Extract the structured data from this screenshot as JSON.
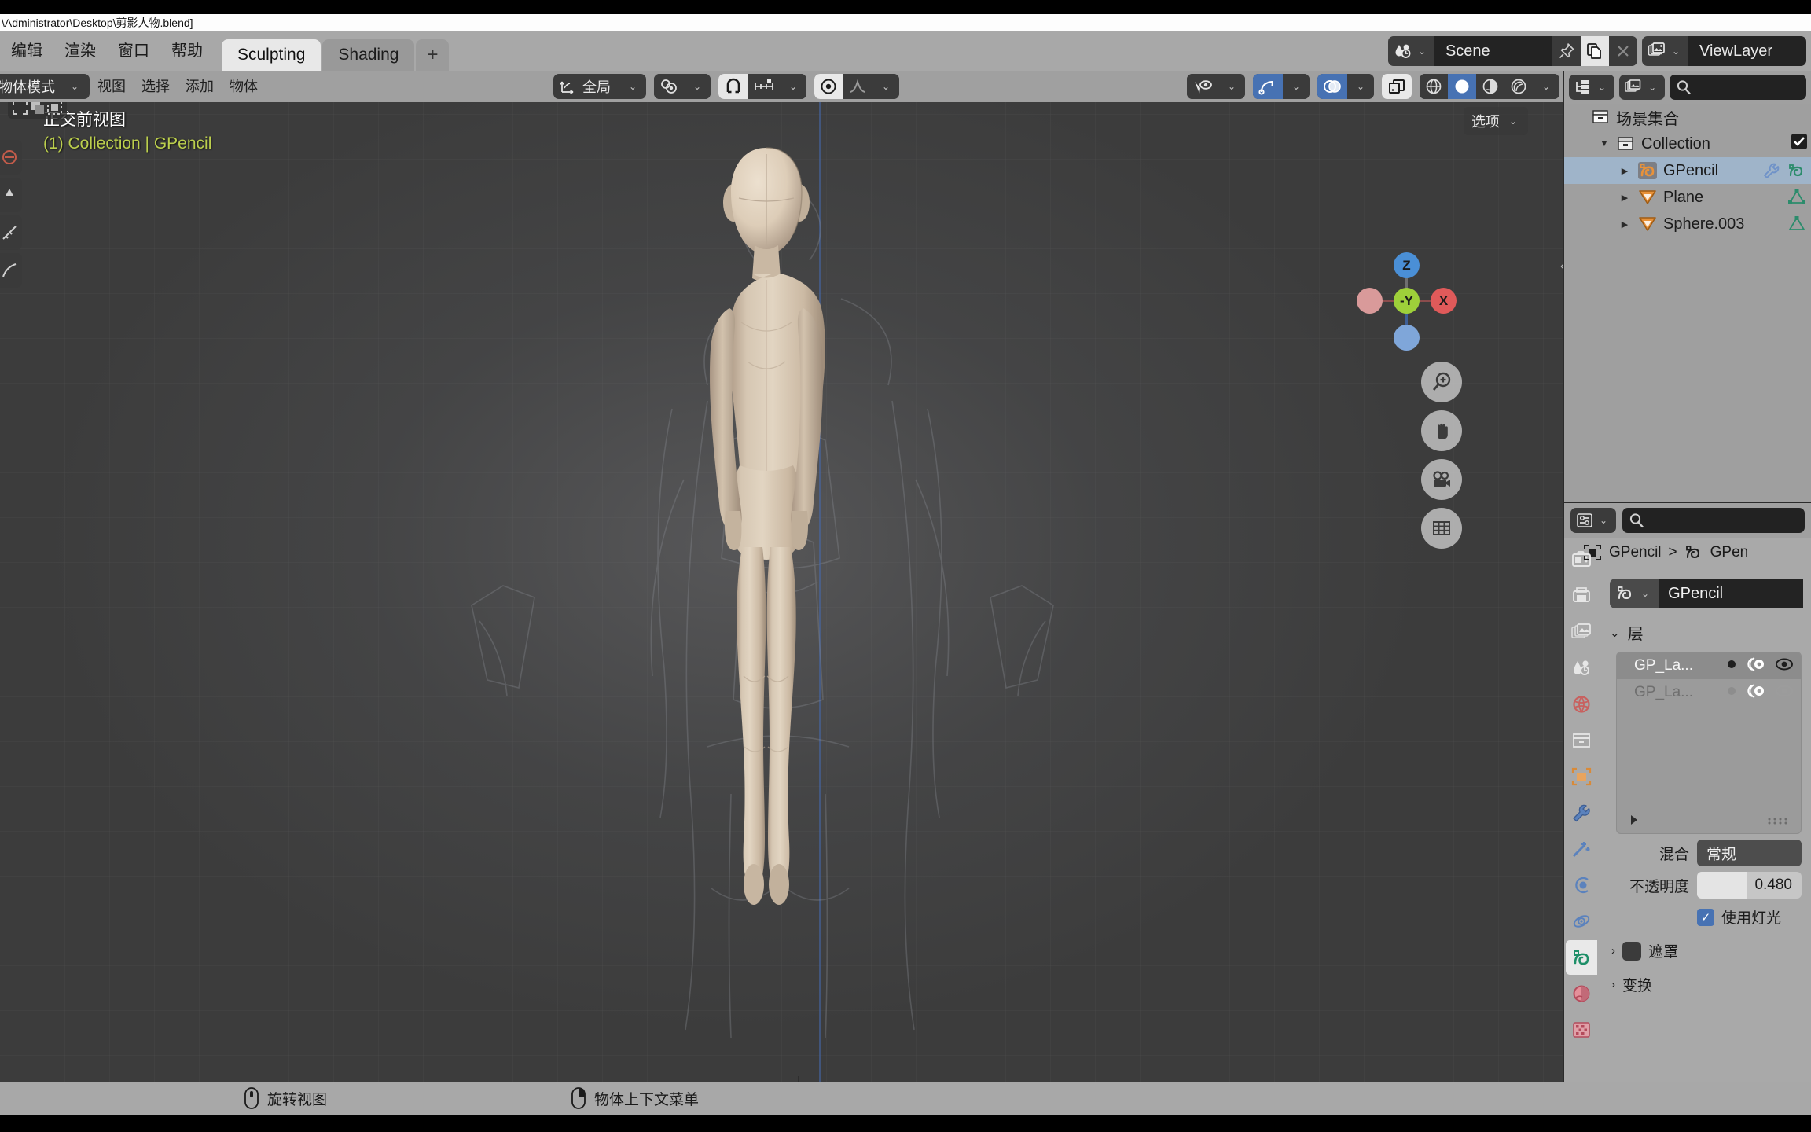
{
  "window": {
    "title": "\\Administrator\\Desktop\\剪影人物.blend]"
  },
  "topbar": {
    "menus": [
      "编辑",
      "渲染",
      "窗口",
      "帮助"
    ],
    "workspace_tabs": [
      {
        "label": "Sculpting",
        "active": true
      },
      {
        "label": "Shading",
        "active": false
      }
    ],
    "add_workspace_label": "+",
    "scene": {
      "icon": "scene-icon",
      "name": "Scene",
      "pin_icon": "pin-icon",
      "new_icon": "duplicate-icon",
      "unlink_icon": "close-icon"
    },
    "view_layer": {
      "icon": "viewlayer-icon",
      "name": "ViewLayer"
    }
  },
  "viewport_header": {
    "mode": "物体模式",
    "menus": [
      "视图",
      "选择",
      "添加",
      "物体"
    ],
    "orientation_label": "全局",
    "snap_icon": "magnet-icon",
    "snap_target_icon": "snap-increment-icon",
    "proportional_icon": "proportional-editing-icon",
    "falloff_icon": "smooth-falloff-icon",
    "visibility_icon": "object-types-visibility-icon",
    "gizmo_icon": "gizmo-icon",
    "overlays_icon": "overlays-icon",
    "xray_icon": "xray-icon",
    "shading_modes": [
      "wireframe",
      "solid",
      "material",
      "rendered"
    ],
    "shading_active": "solid"
  },
  "viewport": {
    "overlay_title": "正交前视图",
    "overlay_subtitle": "(1) Collection | GPencil",
    "options_label": "选项",
    "gizmo_axes": [
      {
        "label": "Z",
        "color": "#4a8fd6"
      },
      {
        "label": "-Y",
        "color": "#9ed03a"
      },
      {
        "label": "X",
        "color": "#e05a5a"
      }
    ],
    "nav_buttons": [
      "zoom-icon",
      "pan-icon",
      "camera-icon",
      "grid-icon"
    ],
    "select_mode_icons": [
      "select-tweak-icon",
      "select-box-icon",
      "select-lasso-icon"
    ],
    "colors": {
      "background": "#3c3c3c",
      "grid": "#4a4a4a",
      "z_axis": "#4669af",
      "x_axis": "#963e3e",
      "cursor": "#ffffff",
      "model": "#cdbda8"
    }
  },
  "outliner": {
    "display_mode_icon": "outliner-display-icon",
    "filter_icon": "viewlayer-filter-icon",
    "search_placeholder": "",
    "search_icon": "search-icon",
    "items": [
      {
        "label": "场景集合",
        "icon": "collection-icon",
        "indent": 0,
        "expanded": null,
        "selected": false
      },
      {
        "label": "Collection",
        "icon": "collection-icon",
        "indent": 1,
        "expanded": true,
        "selected": false
      },
      {
        "label": "GPencil",
        "icon": "gpencil-object-icon",
        "indent": 2,
        "expanded": false,
        "selected": true,
        "extra_icons": [
          "modifier-wrench-icon",
          "gpencil-data-icon"
        ]
      },
      {
        "label": "Plane",
        "icon": "mesh-object-icon",
        "indent": 2,
        "expanded": false,
        "selected": false,
        "extra_icons": [
          "mesh-data-icon"
        ]
      },
      {
        "label": "Sphere.003",
        "icon": "mesh-object-icon",
        "indent": 2,
        "expanded": false,
        "selected": false,
        "extra_icons": [
          "mesh-data-icon"
        ]
      }
    ]
  },
  "properties": {
    "search_icon": "search-icon",
    "breadcrumb": [
      "GPencil",
      "GPen"
    ],
    "breadcrumb_object_icon": "object-icon",
    "breadcrumb_data_icon": "gpencil-data-icon",
    "datablock_name": "GPencil",
    "datablock_icon": "gpencil-data-icon",
    "tabs": [
      {
        "name": "render-tab",
        "icon": "camera-back-icon",
        "active": false
      },
      {
        "name": "output-tab",
        "icon": "printer-icon",
        "active": false
      },
      {
        "name": "view-layer-tab",
        "icon": "images-icon",
        "active": false
      },
      {
        "name": "scene-tab",
        "icon": "scene-cone-icon",
        "active": false
      },
      {
        "name": "world-tab",
        "icon": "world-globe-icon",
        "active": false
      },
      {
        "name": "collection-tab",
        "icon": "collection-box-icon",
        "active": false
      },
      {
        "name": "object-tab",
        "icon": "object-square-icon",
        "active": false
      },
      {
        "name": "modifier-tab",
        "icon": "wrench-icon",
        "active": false
      },
      {
        "name": "effects-tab",
        "icon": "magic-wand-icon",
        "active": false
      },
      {
        "name": "particles-tab",
        "icon": "particles-icon",
        "active": false
      },
      {
        "name": "physics-tab",
        "icon": "physics-orbit-icon",
        "active": false
      },
      {
        "name": "data-tab",
        "icon": "gpencil-data-icon",
        "active": true
      },
      {
        "name": "material-tab",
        "icon": "material-sphere-icon",
        "active": false
      },
      {
        "name": "texture-tab",
        "icon": "texture-checker-icon",
        "active": false
      }
    ],
    "layers_section": {
      "title": "层",
      "expanded": true,
      "rows": [
        {
          "name": "GP_La...",
          "selected": true,
          "dot": "filled",
          "onion_icon": "onion-skin-icon",
          "eye_icon": "eye-open-icon"
        },
        {
          "name": "GP_La...",
          "selected": false,
          "dot": "dim",
          "onion_icon": "onion-skin-icon",
          "eye_icon": "eye-dim-icon"
        }
      ],
      "expand_arrow": "expand-arrow-icon",
      "grip": "grip-dots-icon"
    },
    "blend": {
      "label": "混合",
      "value": "常规"
    },
    "opacity": {
      "label": "不透明度",
      "value": "0.480",
      "fraction": 0.48
    },
    "use_lights": {
      "label": "使用灯光",
      "checked": true
    },
    "mask_panel": {
      "label": "遮罩",
      "expanded": false
    },
    "transform_panel": {
      "label": "变换",
      "expanded": false
    }
  },
  "statusbar": {
    "items": [
      {
        "icon": "mouse-middle-icon",
        "label": "旋转视图"
      },
      {
        "icon": "mouse-right-icon",
        "label": "物体上下文菜单"
      }
    ]
  }
}
